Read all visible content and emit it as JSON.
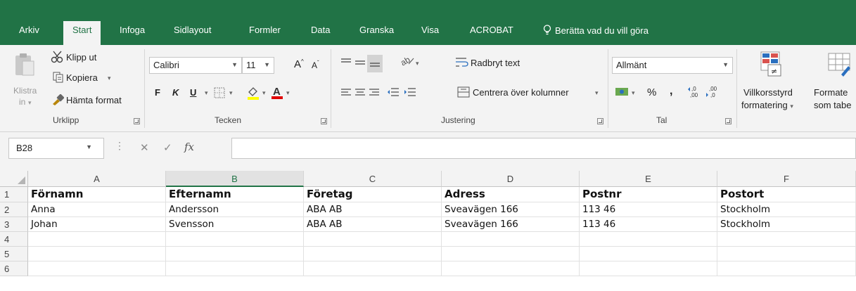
{
  "app": {
    "accent": "#217346"
  },
  "tabs": [
    {
      "label": "Arkiv"
    },
    {
      "label": "Start",
      "active": true
    },
    {
      "label": "Infoga"
    },
    {
      "label": "Sidlayout"
    },
    {
      "label": "Formler"
    },
    {
      "label": "Data"
    },
    {
      "label": "Granska"
    },
    {
      "label": "Visa"
    },
    {
      "label": "ACROBAT"
    }
  ],
  "tell_me": "Berätta vad du vill göra",
  "ribbon": {
    "clipboard": {
      "paste_line1": "Klistra",
      "paste_line2": "in",
      "cut": "Klipp ut",
      "copy": "Kopiera",
      "format_painter": "Hämta format",
      "label": "Urklipp"
    },
    "font": {
      "name": "Calibri",
      "size": "11",
      "bold": "F",
      "italic": "K",
      "underline": "U",
      "label": "Tecken",
      "fill_color": "#ffff00",
      "font_color": "#e00000"
    },
    "alignment": {
      "wrap_text": "Radbryt text",
      "merge_center": "Centrera över kolumner",
      "label": "Justering"
    },
    "number": {
      "format": "Allmänt",
      "percent": "%",
      "comma": ",",
      "label": "Tal"
    },
    "styles": {
      "conditional_1": "Villkorsstyrd",
      "conditional_2": "formatering",
      "table_1": "Formate",
      "table_2": "som tabe"
    }
  },
  "formula_bar": {
    "name_box": "B28",
    "fx": "fx",
    "value": ""
  },
  "grid": {
    "columns": [
      "A",
      "B",
      "C",
      "D",
      "E",
      "F"
    ],
    "selected_column": "B",
    "rows": [
      {
        "num": "1",
        "cells": [
          "Förnamn",
          "Efternamn",
          "Företag",
          "Adress",
          "Postnr",
          "Postort"
        ]
      },
      {
        "num": "2",
        "cells": [
          "Anna",
          "Andersson",
          "ABA AB",
          "Sveavägen 166",
          "113 46",
          "Stockholm"
        ]
      },
      {
        "num": "3",
        "cells": [
          "Johan",
          "Svensson",
          "ABA AB",
          "Sveavägen 166",
          "113 46",
          "Stockholm"
        ]
      },
      {
        "num": "4",
        "cells": [
          "",
          "",
          "",
          "",
          "",
          ""
        ]
      },
      {
        "num": "5",
        "cells": [
          "",
          "",
          "",
          "",
          "",
          ""
        ]
      },
      {
        "num": "6",
        "cells": [
          "",
          "",
          "",
          "",
          "",
          ""
        ]
      }
    ]
  }
}
